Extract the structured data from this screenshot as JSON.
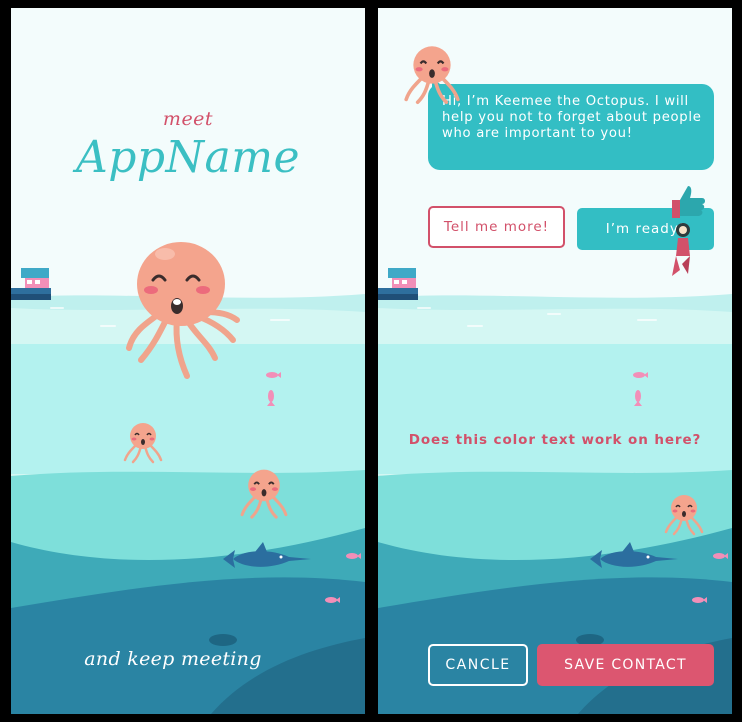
{
  "intro_screen": {
    "meet_text": "meet",
    "app_name": "AppName",
    "tagline": "and keep meeting"
  },
  "chat_screen": {
    "bubble_text": "Hi, I’m Keemee the Octopus. I will help you not to forget about people who are important to you!",
    "tell_me_more_label": "Tell me more!",
    "im_ready_label": "I’m ready!",
    "question_text": "Does this color text work on here?",
    "cancel_label": "CANCLE",
    "save_contact_label": "SAVE CONTACT"
  },
  "colors": {
    "accent_pink": "#d2516a",
    "accent_teal": "#33bec4",
    "app_name_teal": "#3bbfc3",
    "save_button_bg": "#dc5670",
    "sky": "#f3fcfc",
    "deep_water": "#2a7f9c"
  },
  "icons": [
    "octopus-mascot",
    "small-octopus",
    "boat",
    "swordfish",
    "pink-fish",
    "thumbs-up",
    "diver"
  ]
}
